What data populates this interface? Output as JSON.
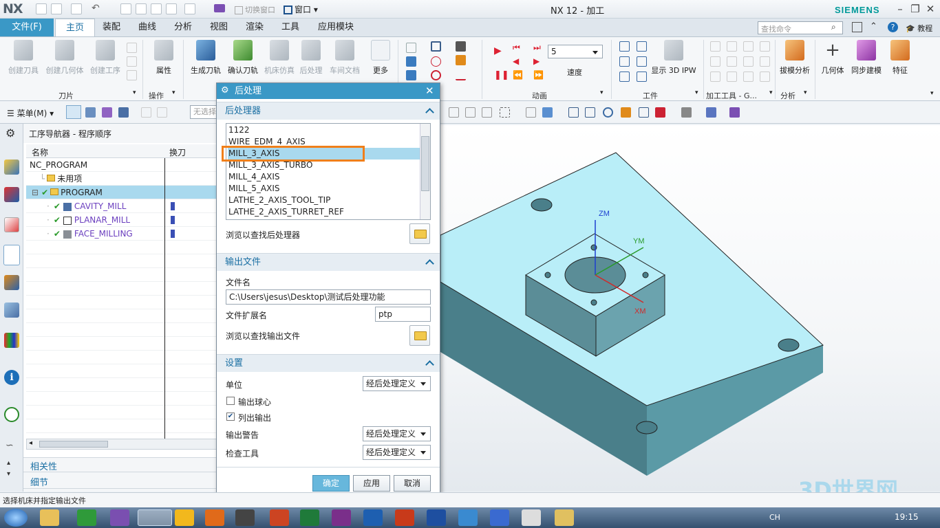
{
  "titlebar": {
    "logo": "NX",
    "switch_window": "切换窗口",
    "window_menu": "窗口",
    "title": "NX 12 - 加工",
    "brand": "SIEMENS",
    "min": "–",
    "restore": "❐",
    "close": "✕"
  },
  "tabs": {
    "file": "文件(F)",
    "items": [
      "主页",
      "装配",
      "曲线",
      "分析",
      "视图",
      "渲染",
      "工具",
      "应用模块"
    ],
    "active": "主页"
  },
  "search": {
    "placeholder": "查找命令"
  },
  "tutorial": "教程",
  "ribbon": {
    "knife_buttons": [
      "创建刀具",
      "创建几何体",
      "创建工序"
    ],
    "attr": "属性",
    "ops": [
      "生成刀轨",
      "确认刀轨",
      "机床仿真",
      "后处理",
      "车间文档"
    ],
    "more": "更多",
    "speed_value": "5",
    "speed": "速度",
    "show_ipw": "显示 3D IPW",
    "right_buttons": [
      "拔模分析",
      "几何体",
      "同步建模",
      "特征"
    ],
    "groups": {
      "tool": "刀片",
      "operate": "操作",
      "animate": "动画",
      "workpiece": "工件",
      "machining_tools": "加工工具 - G...",
      "analysis": "分析"
    }
  },
  "toolbar2": {
    "menu": "菜单(M)",
    "filter_placeholder": "无选择"
  },
  "navigator": {
    "title": "工序导航器 - 程序顺序",
    "col_name": "名称",
    "col_tool": "换刀",
    "rows": [
      {
        "name": "NC_PROGRAM"
      },
      {
        "name": "未用项"
      },
      {
        "name": "PROGRAM"
      },
      {
        "name": "CAVITY_MILL"
      },
      {
        "name": "PLANAR_MILL"
      },
      {
        "name": "FACE_MILLING"
      }
    ],
    "relevance": "相关性",
    "detail": "细节"
  },
  "dialog": {
    "title": "后处理",
    "sec_post": "后处理器",
    "post_list": [
      "1122",
      "WIRE_EDM_4_AXIS",
      "MILL_3_AXIS",
      "MILL_3_AXIS_TURBO",
      "MILL_4_AXIS",
      "MILL_5_AXIS",
      "LATHE_2_AXIS_TOOL_TIP",
      "LATHE_2_AXIS_TURRET_REF"
    ],
    "selected": "MILL_3_AXIS",
    "browse_post": "浏览以查找后处理器",
    "sec_output": "输出文件",
    "file_name_label": "文件名",
    "file_name": "C:\\Users\\jesus\\Desktop\\测试后处理功能",
    "ext_label": "文件扩展名",
    "ext": "ptp",
    "browse_output": "浏览以查找输出文件",
    "sec_settings": "设置",
    "unit_label": "单位",
    "unit": "经后处理定义",
    "ball_center": "输出球心",
    "ball_center_checked": false,
    "list_output": "列出输出",
    "list_output_checked": true,
    "warn_label": "输出警告",
    "warn": "经后处理定义",
    "check_label": "检查工具",
    "check": "经后处理定义",
    "ok": "确定",
    "apply": "应用",
    "cancel": "取消"
  },
  "viewport": {
    "axis_z": "ZM",
    "axis_y": "YM",
    "axis_x": "XM"
  },
  "status": {
    "text": "选择机床并指定输出文件"
  },
  "watermark": "3D世界网",
  "taskbar": {
    "clock": "19:15",
    "lang": "CH"
  }
}
